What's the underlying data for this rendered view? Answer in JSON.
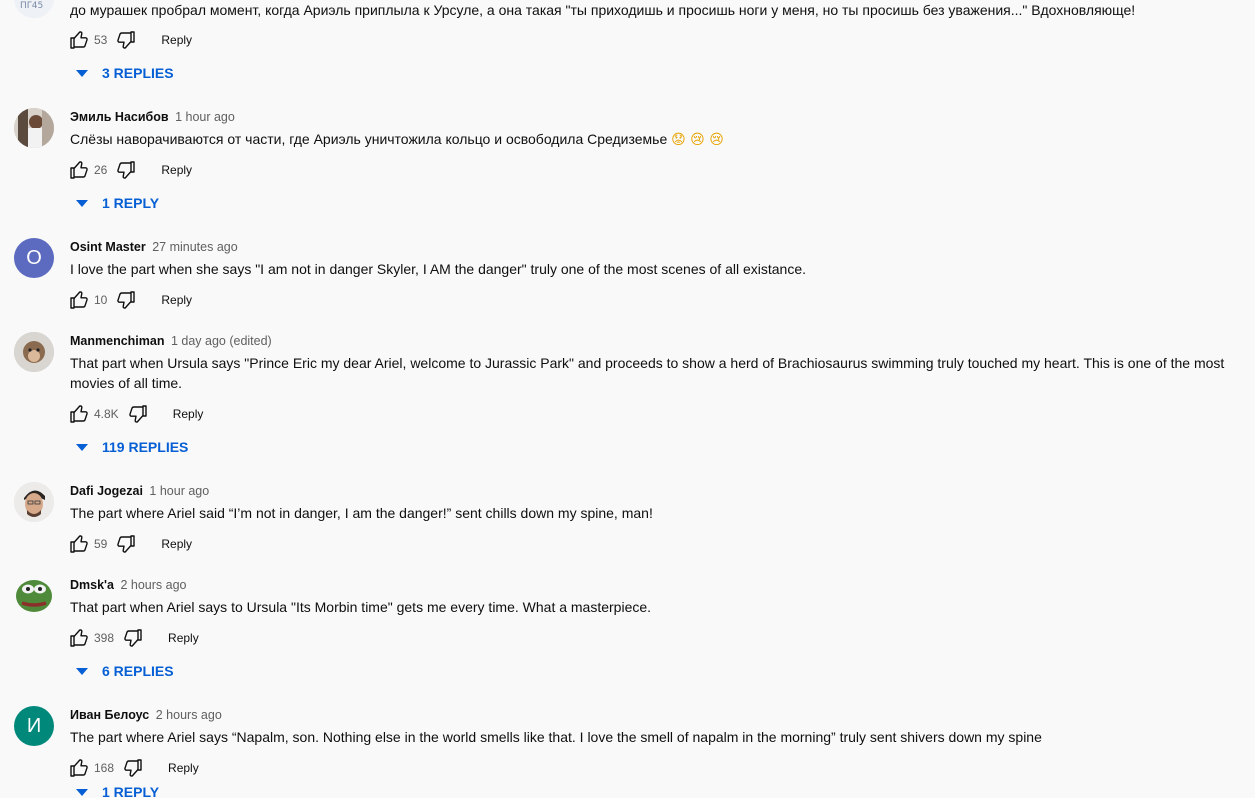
{
  "comments": [
    {
      "text": "до мурашек пробрал момент, когда Ариэль приплыла к Урсуле, а она такая \"ты приходишь и просишь ноги у меня, но ты просишь без уважения...\" Вдохновляюще!",
      "likes": "53",
      "reply_label": "Reply",
      "replies_label": "3 REPLIES"
    },
    {
      "author": "Эмиль Насибов",
      "time": "1 hour ago",
      "text": "Слёзы наворачиваются от части, где Ариэль уничтожила кольцо и освободила Средиземье",
      "emojis": "😟 😢 😢",
      "likes": "26",
      "reply_label": "Reply",
      "replies_label": "1 REPLY"
    },
    {
      "author": "Osint Master",
      "time": "27 minutes ago",
      "avatar_letter": "O",
      "text": "I love the part when she says \"I am not in danger Skyler, I AM the danger\" truly one of the most scenes of all existance.",
      "likes": "10",
      "reply_label": "Reply"
    },
    {
      "author": "Manmenchiman",
      "time": "1 day ago (edited)",
      "text": "That part when Ursula says \"Prince Eric my dear Ariel, welcome to Jurassic Park\" and proceeds to show a herd of Brachiosaurus swimming truly touched my heart. This is one of the most movies of all time.",
      "likes": "4.8K",
      "reply_label": "Reply",
      "replies_label": "119 REPLIES"
    },
    {
      "author": "Dafi Jogezai",
      "time": "1 hour ago",
      "text": "The part where Ariel said “I’m not in danger, I am the danger!” sent chills down my spine, man!",
      "likes": "59",
      "reply_label": "Reply"
    },
    {
      "author": "Dmsk'a",
      "time": "2 hours ago",
      "text": "That part when Ariel says to Ursula \"Its Morbin time\" gets me every time. What a masterpiece.",
      "likes": "398",
      "reply_label": "Reply",
      "replies_label": "6 REPLIES"
    },
    {
      "author": "Иван Белоус",
      "time": "2 hours ago",
      "avatar_letter": "И",
      "text": "The part where Ariel says “Napalm, son. Nothing else in the world smells like that. I love the smell of napalm in the morning” truly sent shivers down my spine",
      "likes": "168",
      "reply_label": "Reply",
      "replies_label": "1 REPLY"
    }
  ],
  "colors": {
    "link_blue": "#065fd4",
    "avatar_osint": "#5c6bc0",
    "avatar_ivan": "#00897b",
    "secondary_text": "#606060"
  },
  "icons": [
    "thumb-up-icon",
    "thumb-down-icon",
    "caret-down-icon"
  ]
}
